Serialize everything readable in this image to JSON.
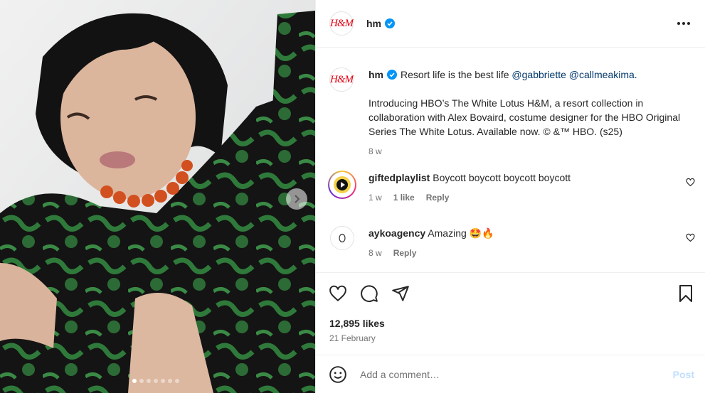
{
  "colors": {
    "accent": "#0095f6",
    "brand": "#e50010",
    "verified": "#0095f6",
    "post_disabled": "#c0dffd"
  },
  "media": {
    "slide_count": 7,
    "active_slide": 1
  },
  "post": {
    "author": {
      "username": "hm",
      "avatar_text": "H&M",
      "verified": true
    },
    "caption": {
      "username": "hm",
      "headline": "Resort life is the best life",
      "mentions": [
        "@gabbriette",
        "@callmeakima."
      ],
      "body": "Introducing HBO’s The White Lotus H&M, a resort collection in collaboration with Alex Bovaird, costume designer for the HBO Original Series The White Lotus. Available now. © &™ HBO. (s25)",
      "age": "8 w"
    },
    "comments": [
      {
        "username": "giftedplaylist",
        "text": "Boycott boycott boycott boycott",
        "age": "1 w",
        "likes": "1 like",
        "reply": "Reply"
      },
      {
        "username": "aykoagency",
        "text": "Amazing 🤩🔥",
        "age": "8 w",
        "reply": "Reply"
      }
    ],
    "likes": "12,895 likes",
    "date": "21 February"
  },
  "composer": {
    "placeholder": "Add a comment…",
    "post_label": "Post"
  }
}
